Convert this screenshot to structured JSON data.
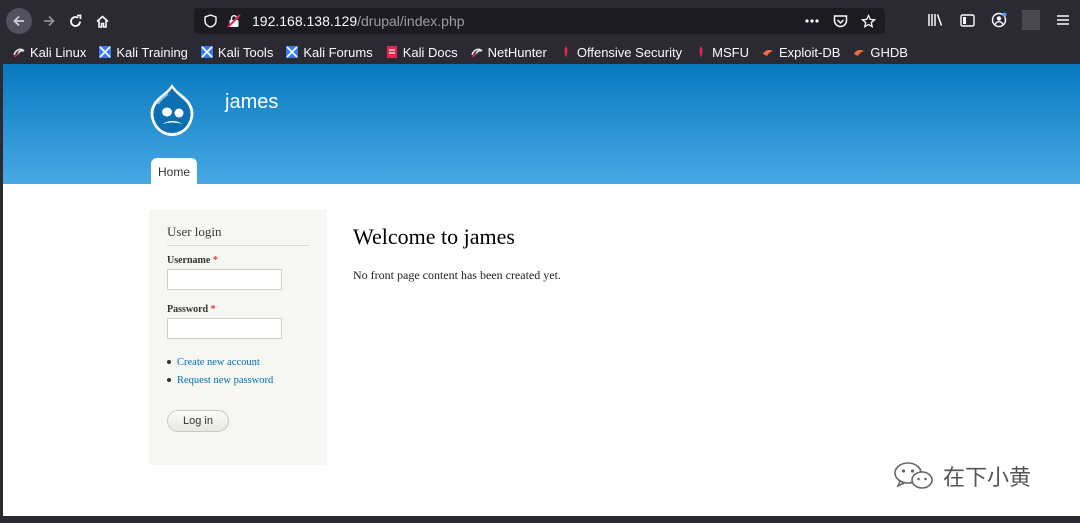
{
  "browser": {
    "url_host": "192.168.138.129",
    "url_path": "/drupal/index.php",
    "bookmarks": [
      {
        "label": "Kali Linux",
        "icon": "kali-icon"
      },
      {
        "label": "Kali Training",
        "icon": "kali-training-icon"
      },
      {
        "label": "Kali Tools",
        "icon": "kali-tools-icon"
      },
      {
        "label": "Kali Forums",
        "icon": "kali-forums-icon"
      },
      {
        "label": "Kali Docs",
        "icon": "kali-docs-icon"
      },
      {
        "label": "NetHunter",
        "icon": "nethunter-icon"
      },
      {
        "label": "Offensive Security",
        "icon": "offsec-icon"
      },
      {
        "label": "MSFU",
        "icon": "msfu-icon"
      },
      {
        "label": "Exploit-DB",
        "icon": "exploitdb-icon"
      },
      {
        "label": "GHDB",
        "icon": "ghdb-icon"
      }
    ]
  },
  "site": {
    "name": "james",
    "tabs": [
      {
        "label": "Home"
      }
    ]
  },
  "sidebar": {
    "title": "User login",
    "username_label": "Username",
    "password_label": "Password",
    "required_mark": "*",
    "username_value": "",
    "password_value": "",
    "links": [
      "Create new account",
      "Request new password"
    ],
    "login_label": "Log in"
  },
  "main": {
    "title": "Welcome to james",
    "text": "No front page content has been created yet."
  },
  "watermark": {
    "text": "在下小黄"
  },
  "colors": {
    "header_top": "#0779bf",
    "header_bottom": "#48a9e4",
    "link": "#0071b3",
    "required": "#ee3333"
  }
}
